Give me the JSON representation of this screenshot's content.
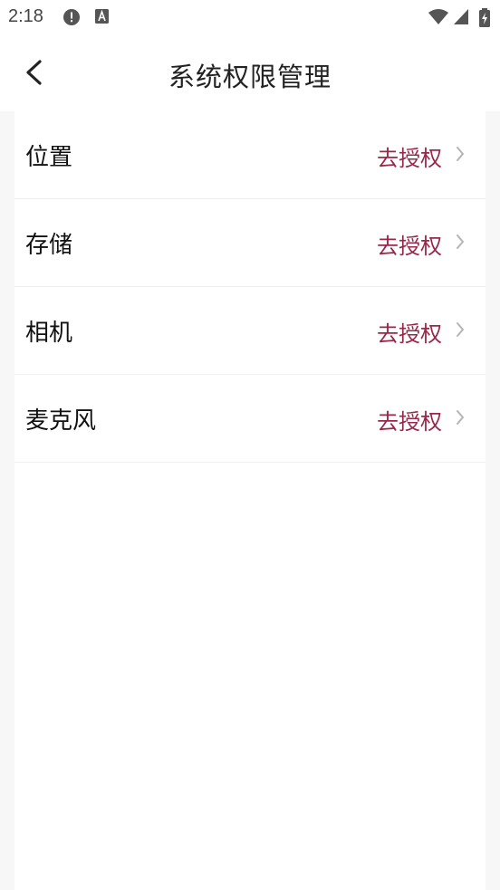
{
  "status_bar": {
    "time": "2:18",
    "icons": [
      "alert-circle-icon",
      "text-a-icon",
      "wifi-icon",
      "signal-icon",
      "battery-charging-icon"
    ]
  },
  "header": {
    "title": "系统权限管理",
    "back_icon": "chevron-left-icon"
  },
  "permissions": [
    {
      "label": "位置",
      "action": "去授权"
    },
    {
      "label": "存储",
      "action": "去授权"
    },
    {
      "label": "相机",
      "action": "去授权"
    },
    {
      "label": "麦克风",
      "action": "去授权"
    }
  ],
  "colors": {
    "accent": "#9b2748",
    "background": "#f7f7f7",
    "card": "#ffffff"
  }
}
